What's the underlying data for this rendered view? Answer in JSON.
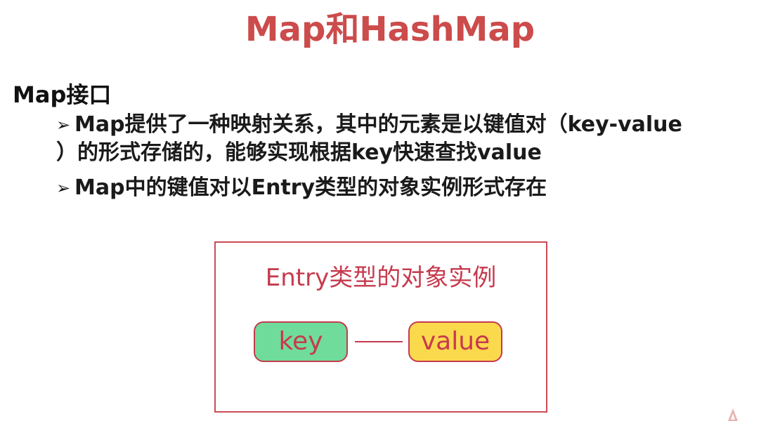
{
  "slide": {
    "title": "Map和HashMap"
  },
  "section": {
    "heading": "Map接口"
  },
  "bullets": [
    {
      "marker": "➢",
      "line1": "Map提供了一种映射关系，其中的元素是以键值对（key-value",
      "line2": "）的形式存储的，能够实现根据key快速查找value"
    },
    {
      "marker": "➢",
      "line1": "Map中的键值对以Entry类型的对象实例形式存在"
    }
  ],
  "diagram": {
    "title": "Entry类型的对象实例",
    "key_label": "key",
    "value_label": "value",
    "colors": {
      "border": "#c63a4d",
      "key_fill": "#6fdc9c",
      "value_fill": "#fbd94c"
    }
  },
  "watermark": {
    "logo_icon": "brand-logo-icon"
  }
}
